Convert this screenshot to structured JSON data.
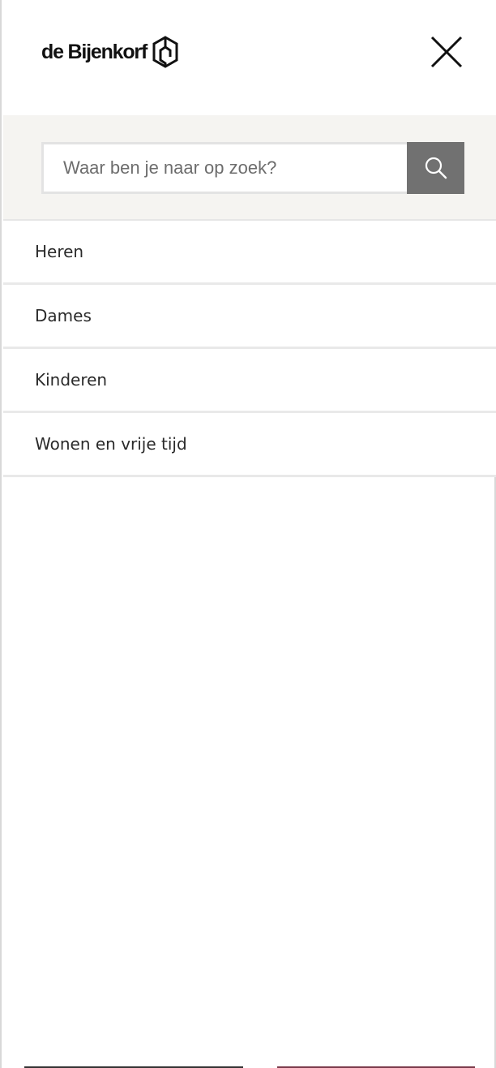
{
  "header": {
    "logo_text": "de Bijenkorf",
    "logo_icon": "bijenkorf-hexagon-logo",
    "close_icon": "close-icon"
  },
  "search": {
    "placeholder": "Waar ben je naar op zoek?",
    "button_icon": "search-icon"
  },
  "menu": {
    "items": [
      {
        "label": "Heren"
      },
      {
        "label": "Dames"
      },
      {
        "label": "Kinderen"
      },
      {
        "label": "Wonen en vrije tijd"
      }
    ]
  },
  "colors": {
    "search_bg": "#f5f4f1",
    "search_button": "#717171",
    "divider": "#e9e9e9"
  }
}
